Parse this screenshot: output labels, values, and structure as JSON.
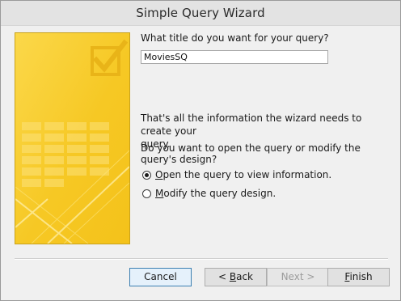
{
  "window": {
    "title": "Simple Query Wizard"
  },
  "wizard": {
    "title_prompt": "What title do you want for your query?",
    "title_value": "MoviesSQ",
    "info_line1": "That's all the information the wizard needs to create your",
    "info_line2": "query.",
    "open_modify_prompt": "Do you want to open the query or modify the query's design?",
    "options": [
      {
        "mnemonic": "O",
        "rest": "pen the query to view information.",
        "selected": true
      },
      {
        "mnemonic": "M",
        "rest": "odify the query design.",
        "selected": false
      }
    ]
  },
  "buttons": {
    "cancel": "Cancel",
    "back_prefix": "< ",
    "back_mnemonic": "B",
    "back_rest": "ack",
    "next": "Next >",
    "finish_mnemonic": "F",
    "finish_rest": "inish"
  },
  "colors": {
    "art_yellow": "#f8cf2a",
    "art_light": "#fde97a",
    "default_button_border": "#3c7fb1"
  },
  "icons": {
    "banner": "query-wizard-checkbox-art"
  }
}
